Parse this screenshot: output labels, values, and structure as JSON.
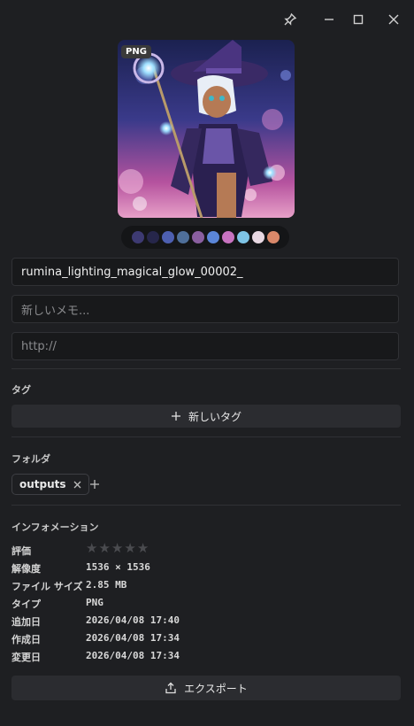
{
  "window": {
    "pin_icon": "pin-icon",
    "minimize_icon": "minimize-icon",
    "maximize_icon": "maximize-icon",
    "close_icon": "close-icon"
  },
  "image": {
    "format_badge": "PNG"
  },
  "palette": [
    "#3d3a72",
    "#26264a",
    "#4d5fb0",
    "#4f6f9a",
    "#8a5fa0",
    "#5b86d8",
    "#c873c0",
    "#7ec4e6",
    "#e8d8e2",
    "#d9886a"
  ],
  "fields": {
    "name_value": "rumina_lighting_magical_glow_00002_",
    "memo_placeholder": "新しいメモ...",
    "url_placeholder": "http://"
  },
  "tags": {
    "title": "タグ",
    "new_tag_label": "新しいタグ"
  },
  "folders": {
    "title": "フォルダ",
    "items": [
      "outputs"
    ]
  },
  "info": {
    "title": "インフォメーション",
    "rating_label": "評価",
    "rating_value": 0,
    "rating_max": 5,
    "rows": [
      {
        "label": "解像度",
        "value": "1536 × 1536"
      },
      {
        "label": "ファイル サイズ",
        "value": "2.85 MB"
      },
      {
        "label": "タイプ",
        "value": "PNG"
      },
      {
        "label": "追加日",
        "value": "2026/04/08 17:40"
      },
      {
        "label": "作成日",
        "value": "2026/04/08 17:34"
      },
      {
        "label": "変更日",
        "value": "2026/04/08 17:34"
      }
    ]
  },
  "export": {
    "label": "エクスポート"
  }
}
